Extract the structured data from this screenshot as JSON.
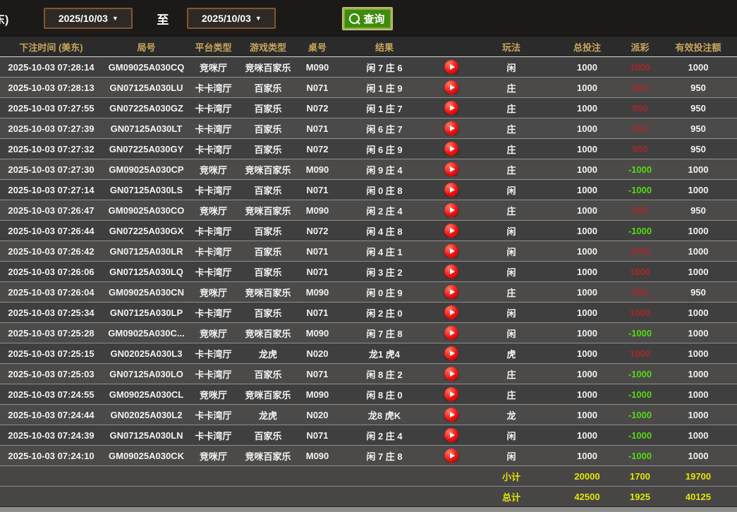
{
  "toolbar": {
    "left_label": "东)",
    "date_from": "2025/10/03",
    "to_label": "至",
    "date_to": "2025/10/03",
    "dropdown_arrow": "▼",
    "search_label": "查询"
  },
  "table": {
    "headers": [
      "下注时间 (美东)",
      "局号",
      "平台类型",
      "游戏类型",
      "桌号",
      "结果",
      "",
      "玩法",
      "总投注",
      "派彩",
      "有效投注额"
    ],
    "rows": [
      {
        "time": "2025-10-03 07:28:14",
        "round": "GM09025A030CQ",
        "platform": "竞咪厅",
        "game": "竞咪百家乐",
        "table_no": "M090",
        "result": "闲 7 庄 6",
        "bet_on": "闲",
        "total_bet": "1000",
        "payout": "1000",
        "valid_bet": "1000"
      },
      {
        "time": "2025-10-03 07:28:13",
        "round": "GN07125A030LU",
        "platform": "卡卡湾厅",
        "game": "百家乐",
        "table_no": "N071",
        "result": "闲 1 庄 9",
        "bet_on": "庄",
        "total_bet": "1000",
        "payout": "950",
        "valid_bet": "950"
      },
      {
        "time": "2025-10-03 07:27:55",
        "round": "GN07225A030GZ",
        "platform": "卡卡湾厅",
        "game": "百家乐",
        "table_no": "N072",
        "result": "闲 1 庄 7",
        "bet_on": "庄",
        "total_bet": "1000",
        "payout": "950",
        "valid_bet": "950"
      },
      {
        "time": "2025-10-03 07:27:39",
        "round": "GN07125A030LT",
        "platform": "卡卡湾厅",
        "game": "百家乐",
        "table_no": "N071",
        "result": "闲 6 庄 7",
        "bet_on": "庄",
        "total_bet": "1000",
        "payout": "950",
        "valid_bet": "950"
      },
      {
        "time": "2025-10-03 07:27:32",
        "round": "GN07225A030GY",
        "platform": "卡卡湾厅",
        "game": "百家乐",
        "table_no": "N072",
        "result": "闲 6 庄 9",
        "bet_on": "庄",
        "total_bet": "1000",
        "payout": "950",
        "valid_bet": "950"
      },
      {
        "time": "2025-10-03 07:27:30",
        "round": "GM09025A030CP",
        "platform": "竞咪厅",
        "game": "竞咪百家乐",
        "table_no": "M090",
        "result": "闲 9 庄 4",
        "bet_on": "庄",
        "total_bet": "1000",
        "payout": "-1000",
        "valid_bet": "1000"
      },
      {
        "time": "2025-10-03 07:27:14",
        "round": "GN07125A030LS",
        "platform": "卡卡湾厅",
        "game": "百家乐",
        "table_no": "N071",
        "result": "闲 0 庄 8",
        "bet_on": "闲",
        "total_bet": "1000",
        "payout": "-1000",
        "valid_bet": "1000"
      },
      {
        "time": "2025-10-03 07:26:47",
        "round": "GM09025A030CO",
        "platform": "竞咪厅",
        "game": "竞咪百家乐",
        "table_no": "M090",
        "result": "闲 2 庄 4",
        "bet_on": "庄",
        "total_bet": "1000",
        "payout": "950",
        "valid_bet": "950"
      },
      {
        "time": "2025-10-03 07:26:44",
        "round": "GN07225A030GX",
        "platform": "卡卡湾厅",
        "game": "百家乐",
        "table_no": "N072",
        "result": "闲 4 庄 8",
        "bet_on": "闲",
        "total_bet": "1000",
        "payout": "-1000",
        "valid_bet": "1000"
      },
      {
        "time": "2025-10-03 07:26:42",
        "round": "GN07125A030LR",
        "platform": "卡卡湾厅",
        "game": "百家乐",
        "table_no": "N071",
        "result": "闲 4 庄 1",
        "bet_on": "闲",
        "total_bet": "1000",
        "payout": "1000",
        "valid_bet": "1000"
      },
      {
        "time": "2025-10-03 07:26:06",
        "round": "GN07125A030LQ",
        "platform": "卡卡湾厅",
        "game": "百家乐",
        "table_no": "N071",
        "result": "闲 3 庄 2",
        "bet_on": "闲",
        "total_bet": "1000",
        "payout": "1000",
        "valid_bet": "1000"
      },
      {
        "time": "2025-10-03 07:26:04",
        "round": "GM09025A030CN",
        "platform": "竞咪厅",
        "game": "竞咪百家乐",
        "table_no": "M090",
        "result": "闲 0 庄 9",
        "bet_on": "庄",
        "total_bet": "1000",
        "payout": "950",
        "valid_bet": "950"
      },
      {
        "time": "2025-10-03 07:25:34",
        "round": "GN07125A030LP",
        "platform": "卡卡湾厅",
        "game": "百家乐",
        "table_no": "N071",
        "result": "闲 2 庄 0",
        "bet_on": "闲",
        "total_bet": "1000",
        "payout": "1000",
        "valid_bet": "1000"
      },
      {
        "time": "2025-10-03 07:25:28",
        "round": "GM09025A030C...",
        "platform": "竞咪厅",
        "game": "竞咪百家乐",
        "table_no": "M090",
        "result": "闲 7 庄 8",
        "bet_on": "闲",
        "total_bet": "1000",
        "payout": "-1000",
        "valid_bet": "1000"
      },
      {
        "time": "2025-10-03 07:25:15",
        "round": "GN02025A030L3",
        "platform": "卡卡湾厅",
        "game": "龙虎",
        "table_no": "N020",
        "result": "龙1 虎4",
        "bet_on": "虎",
        "total_bet": "1000",
        "payout": "1000",
        "valid_bet": "1000"
      },
      {
        "time": "2025-10-03 07:25:03",
        "round": "GN07125A030LO",
        "platform": "卡卡湾厅",
        "game": "百家乐",
        "table_no": "N071",
        "result": "闲 8 庄 2",
        "bet_on": "庄",
        "total_bet": "1000",
        "payout": "-1000",
        "valid_bet": "1000"
      },
      {
        "time": "2025-10-03 07:24:55",
        "round": "GM09025A030CL",
        "platform": "竞咪厅",
        "game": "竞咪百家乐",
        "table_no": "M090",
        "result": "闲 8 庄 0",
        "bet_on": "庄",
        "total_bet": "1000",
        "payout": "-1000",
        "valid_bet": "1000"
      },
      {
        "time": "2025-10-03 07:24:44",
        "round": "GN02025A030L2",
        "platform": "卡卡湾厅",
        "game": "龙虎",
        "table_no": "N020",
        "result": "龙8 虎K",
        "bet_on": "龙",
        "total_bet": "1000",
        "payout": "-1000",
        "valid_bet": "1000"
      },
      {
        "time": "2025-10-03 07:24:39",
        "round": "GN07125A030LN",
        "platform": "卡卡湾厅",
        "game": "百家乐",
        "table_no": "N071",
        "result": "闲 2 庄 4",
        "bet_on": "闲",
        "total_bet": "1000",
        "payout": "-1000",
        "valid_bet": "1000"
      },
      {
        "time": "2025-10-03 07:24:10",
        "round": "GM09025A030CK",
        "platform": "竞咪厅",
        "game": "竞咪百家乐",
        "table_no": "M090",
        "result": "闲 7 庄 8",
        "bet_on": "闲",
        "total_bet": "1000",
        "payout": "-1000",
        "valid_bet": "1000"
      }
    ],
    "subtotal": {
      "label": "小计",
      "total_bet": "20000",
      "payout": "1700",
      "valid_bet": "19700"
    },
    "total": {
      "label": "总计",
      "total_bet": "42500",
      "payout": "1925",
      "valid_bet": "40125"
    }
  },
  "colors": {
    "header_gold": "#c9a55c",
    "payout_win_red": "#a32929",
    "payout_loss_green": "#54d911",
    "summary_yellow": "#e3e600",
    "query_button_green": "#3e8c0d",
    "date_border_brown": "#85552b",
    "play_button_red": "#ee1111"
  }
}
